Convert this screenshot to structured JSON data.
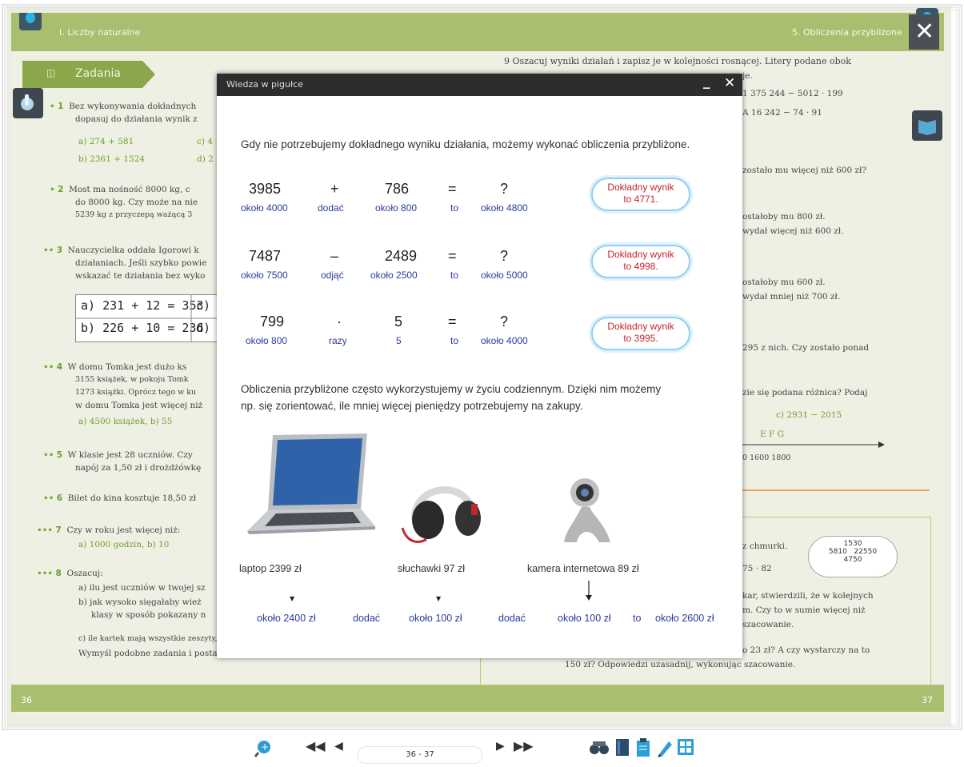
{
  "book": {
    "left_header": "I. Liczby naturalne",
    "right_header": "5. Obliczenia przybliżone",
    "section_label": "Zadania",
    "left_page_number": "36",
    "right_page_number": "37",
    "left_lines": [
      {
        "n": "1",
        "dots": "•",
        "t1": "Bez wykonywania dokładnych",
        "t2": "dopasuj do działania wynik z"
      },
      {
        "a": "a) 274 + 581",
        "c": "c) 4"
      },
      {
        "a": "b) 2361 + 1524",
        "c": "d) 2"
      },
      {
        "n": "2",
        "dots": "•",
        "t1": "Most ma nośność 8000 kg, c",
        "t2": "do 8000 kg. Czy może na nie",
        "t3": "5239 kg z przyczepą ważącą 3"
      },
      {
        "n": "3",
        "dots": "••",
        "t1": "Nauczycielka oddała Igorowi k",
        "t2": "działaniach. Jeśli szybko powie",
        "t3": "wskazać te działania bez wyko"
      },
      {
        "n": "4",
        "dots": "••",
        "t1": "W domu Tomka jest dużo ks",
        "t2": "3155 książek, w pokoju Tomk",
        "t3": "1273 książki. Oprócz tego w ku",
        "t4": "w domu Tomka jest więcej niż",
        "t5": "a) 4500 książek,          b) 55"
      },
      {
        "n": "5",
        "dots": "••",
        "t1": "W klasie jest 28 uczniów. Czy",
        "t2": "napój za 1,50 zł i drożdżówkę"
      },
      {
        "n": "6",
        "dots": "••",
        "t1": "Bilet do kina kosztuje 18,50 zł"
      },
      {
        "n": "7",
        "dots": "•••",
        "t1": "Czy w roku jest więcej niż:",
        "t2": "a) 1000 godzin,          b) 10"
      },
      {
        "n": "8",
        "dots": "•••",
        "t1": "Oszacuj:",
        "t2": "a) ilu jest uczniów w twojej sz",
        "t3": "b) jak wysoko sięgałaby wież",
        "t4": "klasy w sposób pokazany n",
        "t5": "c) ile kartek mają wszystkie zeszyty, którymi wszyscy uczniowie twojej klasy",
        "t6": "Wymyśl podobne zadania i postaraj się je rozwiązać."
      }
    ],
    "grid": [
      "a) 231 + 12 = 353",
      "c)",
      "b) 226 + 10 = 236",
      "d)"
    ],
    "right_lines": [
      "9  Oszacuj wyniki działań i zapisz je w kolejności rosnącej. Litery podane obok",
      "je.",
      "1 375 244 − 5012 · 199",
      "A 16 242 − 74 · 91",
      "zostało mu więcej niż 600 zł?",
      "ostałoby mu 800 zł.",
      "wydał więcej niż 600 zł.",
      "ostałoby mu 600 zł.",
      "wydał mniej niż 700 zł.",
      "295 z nich. Czy zostało ponad",
      "zie się podana różnica? Podaj",
      "c) 2931 − 2015",
      "E        F        G",
      "0        1600        1800",
      "z chmurki.",
      "75 · 82",
      "kar, stwierdzili, że w kolejnych",
      "m. Czy to w sumie więcej niż",
      "szacowanie.",
      "o 23 zł? A czy wystarczy na to",
      "150 zł? Odpowiedzi uzasadnij, wykonując szacowanie."
    ],
    "cloud_numbers": [
      "1530",
      "5810",
      "22550",
      "4750"
    ]
  },
  "modal": {
    "title": "Wiedza w pigułce",
    "minimize": "_",
    "close": "✕",
    "intro": "Gdy nie potrzebujemy dokładnego wyniku działania, możemy wykonać obliczenia przybliżone.",
    "rows": [
      {
        "a": "3985",
        "op": "+",
        "b": "786",
        "eq": "=",
        "q": "?",
        "ra": "około 4000",
        "rop": "dodać",
        "rb": "około 800",
        "rto": "to",
        "rres": "około 4800",
        "cloud1": "Dokładny wynik",
        "cloud2": "to 4771."
      },
      {
        "a": "7487",
        "op": "–",
        "b": "2489",
        "eq": "=",
        "q": "?",
        "ra": "około 7500",
        "rop": "odjąć",
        "rb": "około 2500",
        "rto": "to",
        "rres": "około 5000",
        "cloud1": "Dokładny wynik",
        "cloud2": "to 4998."
      },
      {
        "a": "799",
        "op": "·",
        "b": "5",
        "eq": "=",
        "q": "?",
        "ra": "około 800",
        "rop": "razy",
        "rb": "5",
        "rto": "to",
        "rres": "około 4000",
        "cloud1": "Dokładny wynik",
        "cloud2": "to 3995."
      }
    ],
    "para1": "Obliczenia przybliżone często wykorzystujemy w życiu codziennym. Dzięki nim możemy",
    "para2": "np. się zorientować, ile mniej więcej pieniędzy potrzebujemy na zakupy.",
    "products": [
      {
        "label": "laptop 2399 zł",
        "icon": "laptop-icon"
      },
      {
        "label": "słuchawki 97 zł",
        "icon": "headphones-icon"
      },
      {
        "label": "kamera internetowa 89 zł",
        "icon": "webcam-icon"
      }
    ],
    "sum": {
      "p1": "około 2400 zł",
      "op1": "dodać",
      "p2": "około 100 zł",
      "op2": "dodać",
      "p3": "około 100 zł",
      "to": "to",
      "res": "około 2600 zł"
    }
  },
  "toolbar": {
    "page_indicator": "36 - 37",
    "icons": [
      "zoom-in-icon",
      "first-page-icon",
      "previous-page-icon",
      "next-page-icon",
      "last-page-icon",
      "search-binoculars-icon",
      "notebook-icon",
      "clipboard-icon",
      "pencil-icon",
      "grid-icon"
    ]
  },
  "colors": {
    "accent_green": "#a9bf6f",
    "modal_header": "#2d2d2d",
    "blue_text": "#2b3b9e",
    "red_text": "#c4262e",
    "cloud_border": "#8fd0ee"
  }
}
